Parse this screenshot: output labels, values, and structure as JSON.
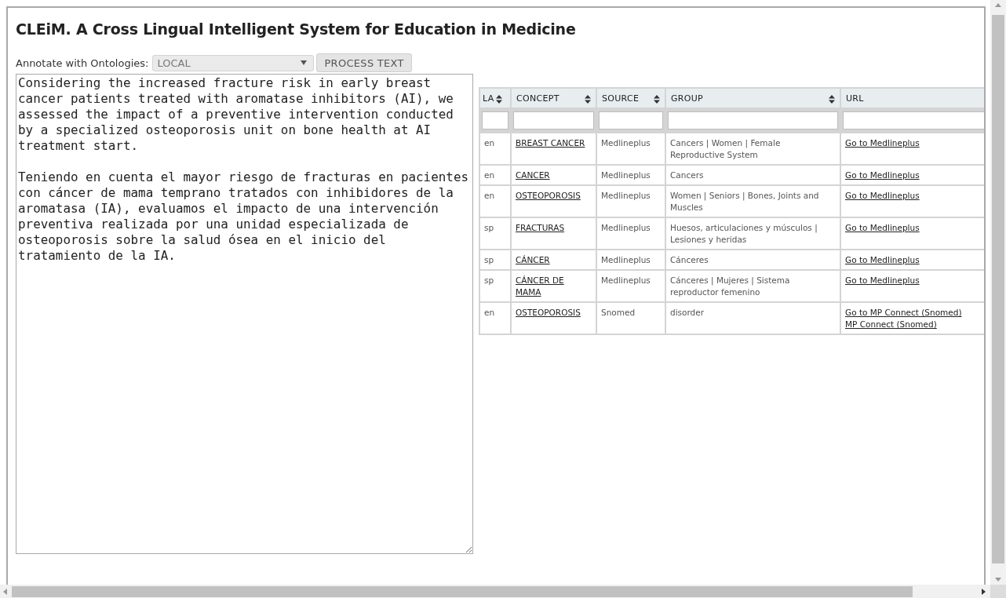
{
  "title": "CLEiM. A Cross Lingual Intelligent System for Education in Medicine",
  "annotate": {
    "label": "Annotate with Ontologies:",
    "select_value": "LOCAL",
    "button": "PROCESS TEXT"
  },
  "text_area": {
    "paragraphs": [
      "Considering the increased fracture risk in early breast cancer patients treated with aromatase inhibitors (AI), we assessed the impact of a preventive intervention conducted by a specialized osteoporosis unit on bone health at AI treatment start.",
      "Teniendo en cuenta el mayor riesgo de fracturas en pacientes con cáncer de mama temprano tratados con inhibidores de la aromatasa (IA), evaluamos el impacto de una intervención preventiva realizada por una unidad especializada de osteoporosis sobre la salud ósea en el inicio del tratamiento de la IA."
    ]
  },
  "table": {
    "columns": [
      {
        "label": "LA",
        "sortable": true
      },
      {
        "label": "CONCEPT",
        "sortable": true
      },
      {
        "label": "SOURCE",
        "sortable": true
      },
      {
        "label": "GROUP",
        "sortable": true
      },
      {
        "label": "URL",
        "sortable": false
      }
    ],
    "rows": [
      {
        "lang": "en",
        "concept": "BREAST CANCER",
        "source": "Medlineplus",
        "group": "Cancers | Women | Female Reproductive System",
        "urls": [
          "Go to Medlineplus"
        ]
      },
      {
        "lang": "en",
        "concept": "CANCER",
        "source": "Medlineplus",
        "group": "Cancers",
        "urls": [
          "Go to Medlineplus"
        ]
      },
      {
        "lang": "en",
        "concept": "OSTEOPOROSIS",
        "source": "Medlineplus",
        "group": "Women | Seniors | Bones, Joints and Muscles",
        "urls": [
          "Go to Medlineplus"
        ]
      },
      {
        "lang": "sp",
        "concept": "FRACTURAS",
        "source": "Medlineplus",
        "group": "Huesos, articulaciones y músculos | Lesiones y heridas",
        "urls": [
          "Go to Medlineplus"
        ]
      },
      {
        "lang": "sp",
        "concept": "CÁNCER",
        "source": "Medlineplus",
        "group": "Cánceres",
        "urls": [
          "Go to Medlineplus"
        ]
      },
      {
        "lang": "sp",
        "concept": "CÁNCER DE MAMA",
        "source": "Medlineplus",
        "group": "Cánceres | Mujeres | Sistema reproductor femenino",
        "urls": [
          "Go to Medlineplus"
        ]
      },
      {
        "lang": "en",
        "concept": "OSTEOPOROSIS",
        "source": "Snomed",
        "group": "disorder",
        "urls": [
          "Go to MP Connect (Snomed)",
          "MP Connect (Snomed)"
        ]
      }
    ]
  }
}
